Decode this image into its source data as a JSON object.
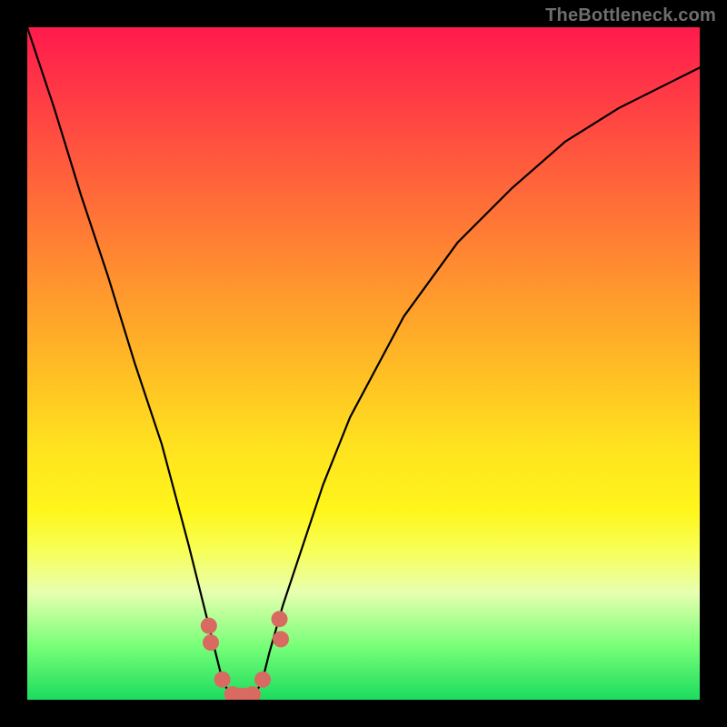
{
  "watermark": "TheBottleneck.com",
  "colors": {
    "frame": "#000000",
    "gradient_top": "#ff1a4d",
    "gradient_mid": "#ffe11f",
    "gradient_bottom": "#1cdc5e",
    "curve": "#000000",
    "marker": "#d86a62"
  },
  "chart_data": {
    "type": "line",
    "title": "",
    "xlabel": "",
    "ylabel": "",
    "xlim": [
      0,
      100
    ],
    "ylim": [
      0,
      100
    ],
    "grid": false,
    "series": [
      {
        "name": "bottleneck-curve",
        "x": [
          0,
          4,
          8,
          12,
          16,
          20,
          24,
          26,
          28,
          29,
          30,
          31,
          32,
          33,
          34,
          35,
          36,
          38,
          40,
          44,
          48,
          56,
          64,
          72,
          80,
          88,
          96,
          100
        ],
        "values": [
          100,
          88,
          75,
          63,
          50,
          38,
          23,
          15,
          7,
          3,
          1,
          0,
          0,
          0,
          1,
          3,
          7,
          14,
          20,
          32,
          42,
          57,
          68,
          76,
          83,
          88,
          92,
          94
        ]
      }
    ],
    "markers": {
      "name": "highlighted-dots",
      "x": [
        27.0,
        27.3,
        29.0,
        30.5,
        31.5,
        32.5,
        33.5,
        35.0,
        37.5,
        37.7
      ],
      "values": [
        11.0,
        8.5,
        3.0,
        0.8,
        0.6,
        0.6,
        0.8,
        3.0,
        12.0,
        9.0
      ]
    }
  }
}
